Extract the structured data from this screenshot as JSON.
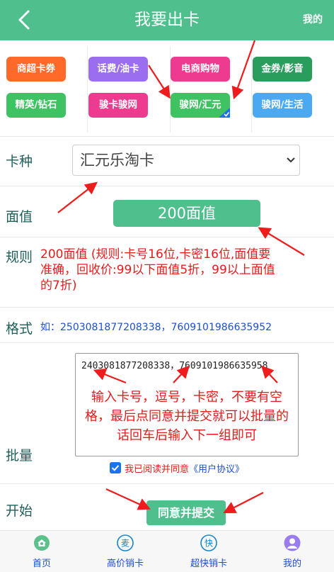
{
  "header": {
    "title": "我要出卡",
    "mine": "我的"
  },
  "categories": [
    {
      "label": "商超卡券",
      "color": "#ff6a2b"
    },
    {
      "label": "话费/油卡",
      "color": "#9b6ef0"
    },
    {
      "label": "电商购物",
      "color": "#ee3b8f"
    },
    {
      "label": "金券/影音",
      "color": "#2a9d5c"
    },
    {
      "label": "精英/钻石",
      "color": "#3fc262"
    },
    {
      "label": "骏卡骏网",
      "color": "#ee3b8f"
    },
    {
      "label": "骏网/汇元",
      "color": "#3fc262",
      "selected": true
    },
    {
      "label": "骏网/生活",
      "color": "#4aa9f0"
    }
  ],
  "form": {
    "card_type_label": "卡种",
    "card_type_value": "汇元乐淘卡",
    "face_value_label": "面值",
    "face_value": "200面值",
    "rule_label": "规则",
    "rule_text": "200面值 (规则:卡号16位,卡密16位,面值要准确，回收价:99以下面值5折，99以上面值的7折)",
    "format_label": "格式",
    "format_text": "如：2503081877208338，7609101986635952",
    "batch_label": "批量",
    "batch_value": "2403081877208338，7609101986635958",
    "batch_hint": "输入卡号，逗号，卡密，不要有空格，最后点同意并提交就可以批量的话回车后输入下一组即可",
    "agree_text": "我已阅读并同意",
    "agree_link": "《用户协议》",
    "start_label": "开始",
    "submit": "同意并提交"
  },
  "tabbar": [
    {
      "label": "首页",
      "icon": "home-icon"
    },
    {
      "label": "高价销卡",
      "icon": "sell-mai-icon"
    },
    {
      "label": "超快销卡",
      "icon": "fast-kuai-icon"
    },
    {
      "label": "我的",
      "icon": "user-icon"
    }
  ],
  "colors": {
    "primary": "#4fc08d",
    "red": "#e51c1c",
    "blue": "#1f4fcf"
  },
  "tab_glyphs": {
    "mai": "麦",
    "kuai": "快"
  }
}
